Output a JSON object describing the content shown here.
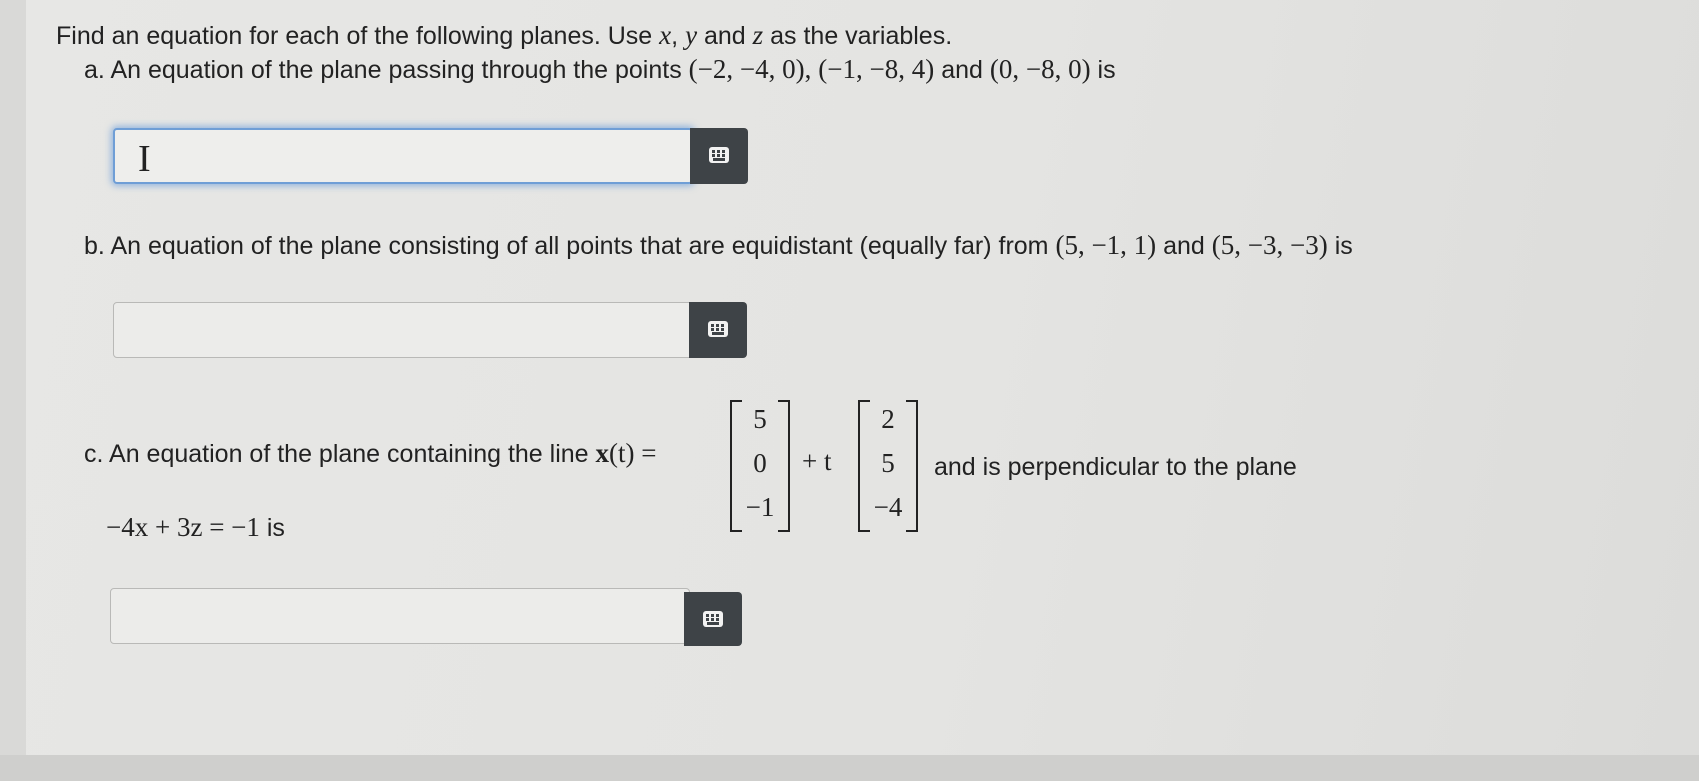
{
  "instructions": "Find an equation for each of the following planes. Use x, y and z as the variables.",
  "instructions_parts": {
    "before": "Find an equation for each of the following planes. Use ",
    "x": "x",
    "sep1": ", ",
    "y": "y",
    "and": " and ",
    "z": "z",
    "after": " as the variables."
  },
  "part_a": {
    "label": "a.",
    "text": "An equation of the plane passing through the points",
    "p1": "(−2, −4, 0)",
    "sep": ",",
    "p2": "(−1, −8, 4)",
    "and": "and",
    "p3": "(0, −8, 0)",
    "is": "is",
    "answer_value": ""
  },
  "part_b": {
    "label": "b.",
    "text": "An equation of the plane consisting of all points that are equidistant (equally far) from",
    "p1": "(5, −1, 1)",
    "and": "and",
    "p2": "(5, −3, −3)",
    "is": "is",
    "answer_value": ""
  },
  "part_c": {
    "label": "c.",
    "text": "An equation of the plane containing the line",
    "line_lhs": "x",
    "line_arg": "(t) =",
    "vec1": [
      "5",
      "0",
      "−1"
    ],
    "plus_t": "+ t",
    "vec2": [
      "2",
      "5",
      "−4"
    ],
    "text2": "and is perpendicular to the plane",
    "plane_eq": "−4x + 3z = −1",
    "is": "is",
    "answer_value": ""
  },
  "icons": {
    "keyboard": "keyboard-icon",
    "text_cursor": "text-cursor-icon"
  },
  "colors": {
    "focus_ring": "#6f9ed6",
    "keyboard_button": "#3e4347"
  }
}
